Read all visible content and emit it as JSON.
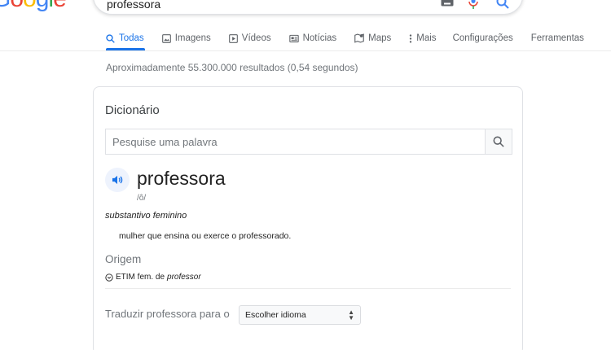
{
  "header": {
    "logo_text": [
      "G",
      "o",
      "o",
      "g",
      "l",
      "e"
    ],
    "search_query": "professora",
    "icons": [
      "keyboard-icon",
      "microphone-icon",
      "search-icon"
    ]
  },
  "tabs": [
    {
      "label": "Todas",
      "icon": "search-icon",
      "active": true
    },
    {
      "label": "Imagens",
      "icon": "image-icon",
      "active": false
    },
    {
      "label": "Vídeos",
      "icon": "video-icon",
      "active": false
    },
    {
      "label": "Notícias",
      "icon": "news-icon",
      "active": false
    },
    {
      "label": "Maps",
      "icon": "map-icon",
      "active": false
    },
    {
      "label": "Mais",
      "icon": "more-vert-icon",
      "active": false
    }
  ],
  "tabs_right": [
    "Configurações",
    "Ferramentas"
  ],
  "results_count": "Aproximadamente 55.300.000 resultados (0,54 segundos)",
  "dictionary": {
    "title": "Dicionário",
    "search_placeholder": "Pesquise uma palavra",
    "word": "professora",
    "phonetic": "/ô/",
    "part_of_speech": "substantivo feminino",
    "definition": "mulher que ensina ou exerce o professorado.",
    "origin_title": "Origem",
    "etymology_prefix": "ETIM fem. de",
    "etymology_word": "professor",
    "translate_label": "Traduzir professora para o",
    "language_select": "Escolher idioma"
  },
  "colors": {
    "accent": "#1a73e8",
    "muted_text": "#70757a",
    "border": "#dfe1e5"
  }
}
